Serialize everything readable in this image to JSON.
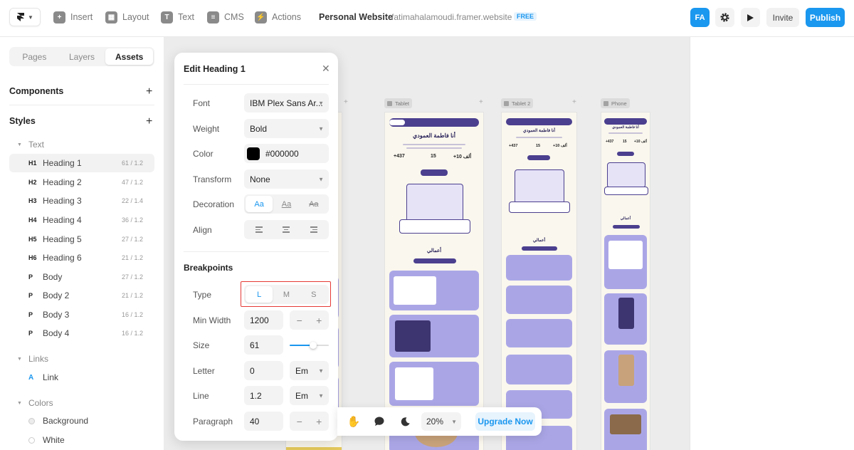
{
  "toolbar": {
    "insert": "Insert",
    "layout": "Layout",
    "text": "Text",
    "cms": "CMS",
    "actions": "Actions"
  },
  "project": {
    "name": "Personal Website",
    "separator": "·",
    "url": "fatimahalamoudi.framer.website",
    "plan_badge": "FREE"
  },
  "user": {
    "initials": "FA"
  },
  "actions": {
    "invite": "Invite",
    "publish": "Publish"
  },
  "sidebar": {
    "tabs": [
      "Pages",
      "Layers",
      "Assets"
    ],
    "active_tab": "Assets",
    "components_label": "Components",
    "styles_label": "Styles",
    "text_group": "Text",
    "text_styles": [
      {
        "tag": "H1",
        "name": "Heading 1",
        "value": "61 / 1.2"
      },
      {
        "tag": "H2",
        "name": "Heading 2",
        "value": "47 / 1.2"
      },
      {
        "tag": "H3",
        "name": "Heading 3",
        "value": "22 / 1.4"
      },
      {
        "tag": "H4",
        "name": "Heading 4",
        "value": "36 / 1.2"
      },
      {
        "tag": "H5",
        "name": "Heading 5",
        "value": "27 / 1.2"
      },
      {
        "tag": "H6",
        "name": "Heading 6",
        "value": "21 / 1.2"
      },
      {
        "tag": "P",
        "name": "Body",
        "value": "27 / 1.2"
      },
      {
        "tag": "P",
        "name": "Body 2",
        "value": "21 / 1.2"
      },
      {
        "tag": "P",
        "name": "Body 3",
        "value": "16 / 1.2"
      },
      {
        "tag": "P",
        "name": "Body 4",
        "value": "16 / 1.2"
      }
    ],
    "links_group": "Links",
    "link_style": {
      "tag": "A",
      "name": "Link"
    },
    "colors_group": "Colors",
    "colors": [
      {
        "name": "Background",
        "color": "#ececec"
      },
      {
        "name": "White",
        "color": "#ffffff"
      }
    ]
  },
  "frames": {
    "tablet": "Tablet",
    "tablet2": "Tablet 2",
    "phone": "Phone",
    "site_title": "أنا فاطمة العمودي",
    "stat_1": "+437",
    "stat_2": "15",
    "stat_3": "+10 ألف",
    "works_title": "أعمالي"
  },
  "edit_panel": {
    "title": "Edit Heading 1",
    "font_label": "Font",
    "font_value": "IBM Plex Sans Ar...",
    "weight_label": "Weight",
    "weight_value": "Bold",
    "color_label": "Color",
    "color_value": "#000000",
    "transform_label": "Transform",
    "transform_value": "None",
    "decoration_label": "Decoration",
    "decoration_options": [
      "Aa",
      "Aa",
      "Aa"
    ],
    "align_label": "Align",
    "breakpoints_label": "Breakpoints",
    "type_label": "Type",
    "type_options": [
      "L",
      "M",
      "S"
    ],
    "min_width_label": "Min Width",
    "min_width_value": "1200",
    "size_label": "Size",
    "size_value": "61",
    "size_slider_fraction": 0.6,
    "letter_label": "Letter",
    "letter_value": "0",
    "letter_unit": "Em",
    "line_label": "Line",
    "line_value": "1.2",
    "line_unit": "Em",
    "paragraph_label": "Paragraph",
    "paragraph_value": "40",
    "minus": "−",
    "plus": "+"
  },
  "bottom_bar": {
    "zoom": "20%",
    "upgrade": "Upgrade Now"
  },
  "colors": {
    "accent": "#1a97ef",
    "highlight": "#e53935",
    "site_purple": "#4b3f8f"
  }
}
